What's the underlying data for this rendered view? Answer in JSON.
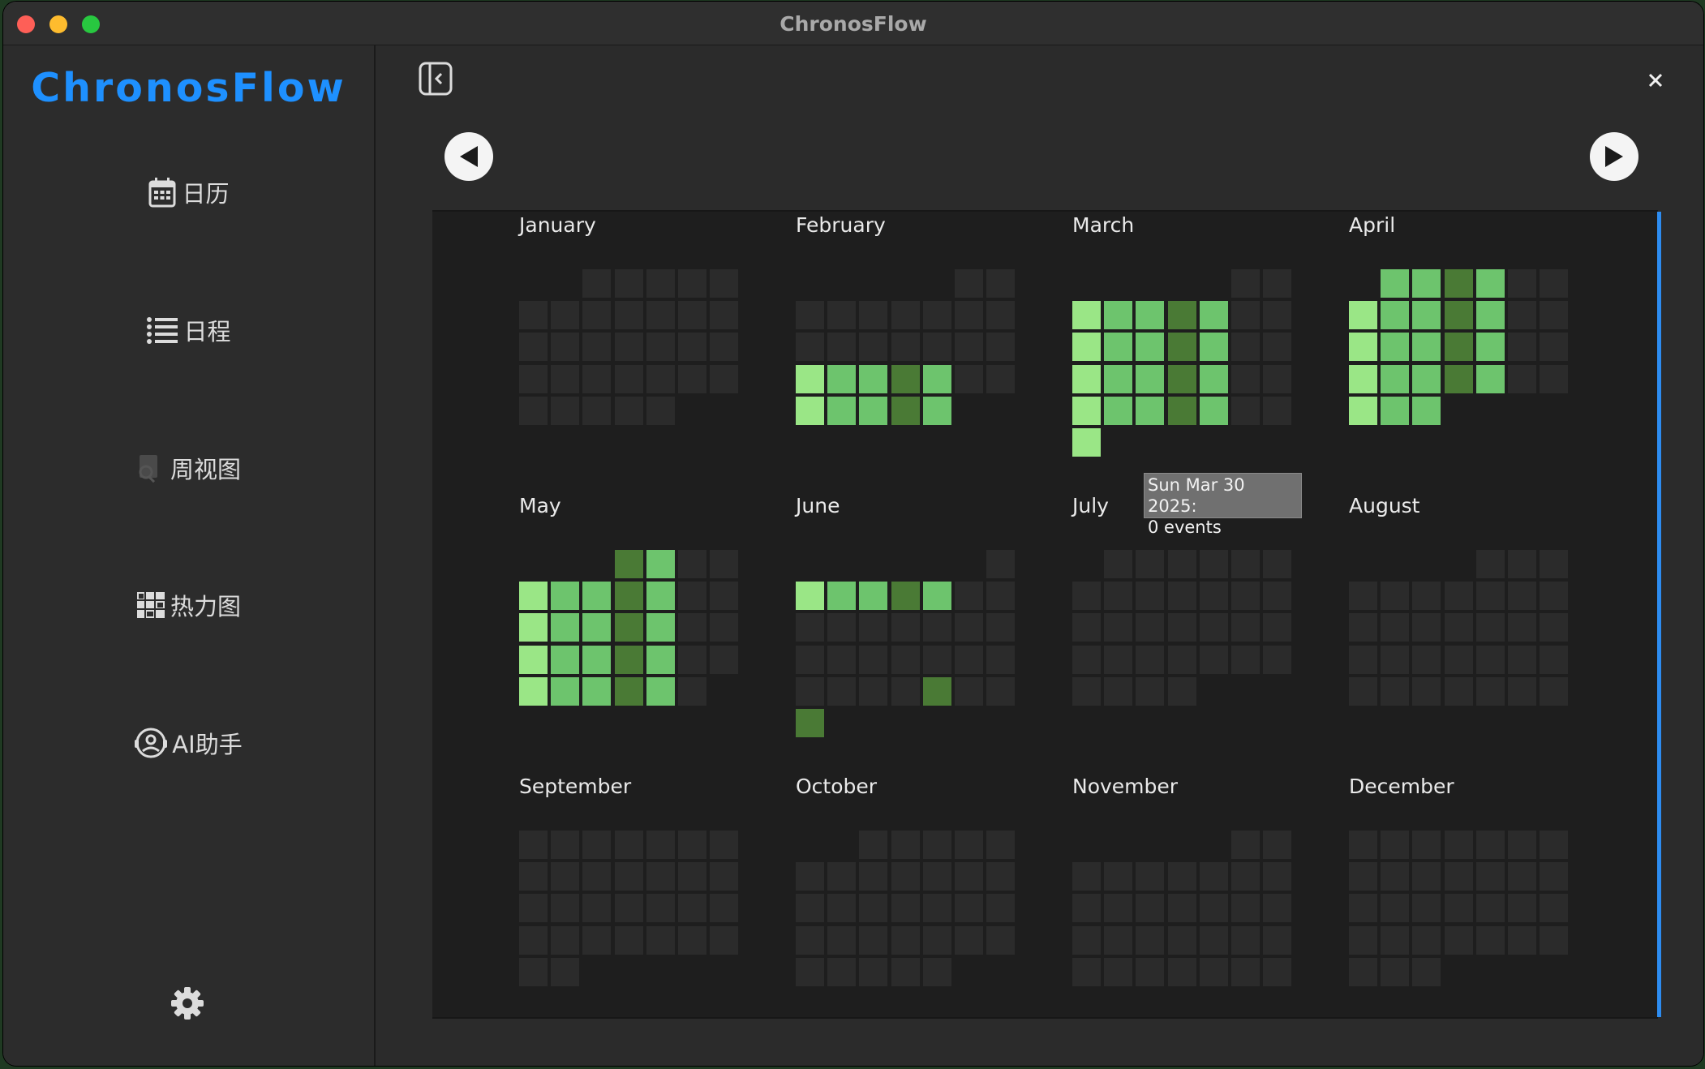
{
  "window": {
    "title": "ChronosFlow"
  },
  "sidebar": {
    "brand": "ChronosFlow",
    "items": [
      {
        "label": "日历",
        "icon": "calendar-icon"
      },
      {
        "label": "日程",
        "icon": "list-icon"
      },
      {
        "label": "周视图",
        "icon": "week-view-icon"
      },
      {
        "label": "热力图",
        "icon": "heatmap-icon"
      },
      {
        "label": "AI助手",
        "icon": "ai-assistant-icon"
      }
    ],
    "settings_icon": "gear-icon"
  },
  "toolbar": {
    "collapse_icon": "sidebar-collapse-icon",
    "close_icon": "close-icon",
    "prev_icon": "arrow-left-icon",
    "next_icon": "arrow-right-icon"
  },
  "heatmap": {
    "year": 2025,
    "week_start": "Monday",
    "colors": {
      "empty": "#2b2b2b",
      "light": "#9ae686",
      "mid": "#6dc46d",
      "dark": "#4a7a35"
    },
    "months": [
      {
        "name": "January",
        "days": 31,
        "first_weekday": 2,
        "levels": {}
      },
      {
        "name": "February",
        "days": 28,
        "first_weekday": 5,
        "levels": {
          "17": "light",
          "18": "mid",
          "19": "mid",
          "20": "dark",
          "21": "mid",
          "24": "light",
          "25": "mid",
          "26": "mid",
          "27": "dark",
          "28": "mid"
        }
      },
      {
        "name": "March",
        "days": 31,
        "first_weekday": 5,
        "levels": {
          "3": "light",
          "4": "mid",
          "5": "mid",
          "6": "dark",
          "7": "mid",
          "10": "light",
          "11": "mid",
          "12": "mid",
          "13": "dark",
          "14": "mid",
          "17": "light",
          "18": "mid",
          "19": "mid",
          "20": "dark",
          "21": "mid",
          "24": "light",
          "25": "mid",
          "26": "mid",
          "27": "dark",
          "28": "mid",
          "31": "light"
        }
      },
      {
        "name": "April",
        "days": 30,
        "first_weekday": 1,
        "levels": {
          "1": "mid",
          "2": "mid",
          "3": "dark",
          "4": "mid",
          "7": "light",
          "8": "mid",
          "9": "mid",
          "10": "dark",
          "11": "mid",
          "14": "light",
          "15": "mid",
          "16": "mid",
          "17": "dark",
          "18": "mid",
          "21": "light",
          "22": "mid",
          "23": "mid",
          "24": "dark",
          "25": "mid",
          "28": "light",
          "29": "mid",
          "30": "mid"
        }
      },
      {
        "name": "May",
        "days": 31,
        "first_weekday": 3,
        "levels": {
          "1": "dark",
          "2": "mid",
          "5": "light",
          "6": "mid",
          "7": "mid",
          "8": "dark",
          "9": "mid",
          "12": "light",
          "13": "mid",
          "14": "mid",
          "15": "dark",
          "16": "mid",
          "19": "light",
          "20": "mid",
          "21": "mid",
          "22": "dark",
          "23": "mid",
          "26": "light",
          "27": "mid",
          "28": "mid",
          "29": "dark",
          "30": "mid"
        }
      },
      {
        "name": "June",
        "days": 30,
        "first_weekday": 6,
        "levels": {
          "2": "light",
          "3": "mid",
          "4": "mid",
          "5": "dark",
          "6": "mid",
          "27": "dark",
          "30": "dark"
        }
      },
      {
        "name": "July",
        "days": 31,
        "first_weekday": 1,
        "levels": {}
      },
      {
        "name": "August",
        "days": 31,
        "first_weekday": 4,
        "levels": {}
      },
      {
        "name": "September",
        "days": 30,
        "first_weekday": 0,
        "levels": {}
      },
      {
        "name": "October",
        "days": 31,
        "first_weekday": 2,
        "levels": {}
      },
      {
        "name": "November",
        "days": 30,
        "first_weekday": 5,
        "levels": {}
      },
      {
        "name": "December",
        "days": 31,
        "first_weekday": 0,
        "levels": {}
      }
    ]
  },
  "tooltip": {
    "date": "Sun Mar 30 2025:",
    "events": "0 events"
  }
}
